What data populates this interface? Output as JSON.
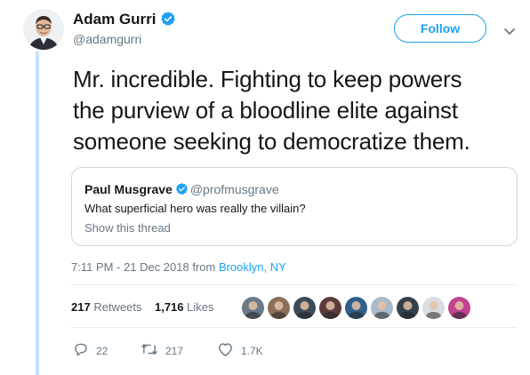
{
  "author": {
    "name": "Adam Gurri",
    "handle": "@adamgurri"
  },
  "follow_label": "Follow",
  "tweet": {
    "lines": [
      "Mr. incredible. Fighting to keep powers",
      "the purview of a bloodline elite against",
      "someone seeking to democratize them."
    ]
  },
  "quote": {
    "name": "Paul Musgrave",
    "handle": "@profmusgrave",
    "text": "What superficial hero was really the villain?",
    "show_thread": "Show this thread"
  },
  "meta": {
    "time": "7:11 PM - 21 Dec 2018 from ",
    "location": "Brooklyn, NY"
  },
  "stats": {
    "retweets_count": "217",
    "retweets_label": "Retweets",
    "likes_count": "1,716",
    "likes_label": "Likes"
  },
  "likers": [
    "#6b7a89",
    "#8a6f5a",
    "#3d4a57",
    "#5c3b3b",
    "#2f5f8a",
    "#a8b9c9",
    "#33414d",
    "#d9dde2",
    "#c2428f"
  ],
  "actions": {
    "replies": "22",
    "retweets": "217",
    "likes": "1.7K"
  },
  "colors": {
    "accent": "#1da1f2",
    "muted": "#657786",
    "thread_line": "#c4e3f7"
  }
}
